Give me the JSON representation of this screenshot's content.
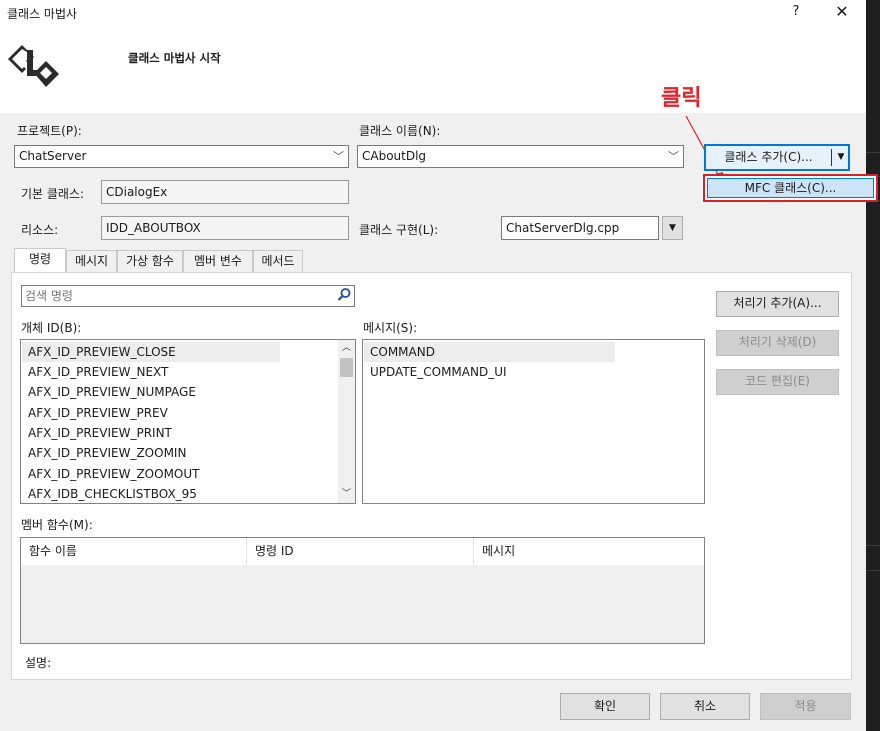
{
  "window": {
    "title": "클래스 마법사",
    "help_label": "?",
    "close_label": "✕",
    "wizard_start_label": "클래스 마법사 시작",
    "logo_icon": "class-wizard-icon"
  },
  "annotation": {
    "click_label": "클릭",
    "color": "#e8202a"
  },
  "project": {
    "label": "프로젝트(P):",
    "value": "ChatServer"
  },
  "class_name": {
    "label": "클래스 이름(N):",
    "value": "CAboutDlg"
  },
  "add_class": {
    "label": "클래스 추가(C)...",
    "dropdown_icon": "chevron-down-icon",
    "menu_item": "MFC 클래스(C)..."
  },
  "base_class": {
    "label": "기본 클래스:",
    "value": "CDialogEx"
  },
  "resource": {
    "label": "리소스:",
    "value": "IDD_ABOUTBOX"
  },
  "class_impl": {
    "label": "클래스 구현(L):",
    "value": "ChatServerDlg.cpp"
  },
  "tabs": [
    {
      "label": "명령"
    },
    {
      "label": "메시지"
    },
    {
      "label": "가상 함수"
    },
    {
      "label": "멤버 변수"
    },
    {
      "label": "메서드"
    }
  ],
  "search": {
    "placeholder": "검색 명령",
    "icon": "search-icon"
  },
  "object_ids": {
    "label": "개체 ID(B):",
    "items": [
      "AFX_ID_PREVIEW_CLOSE",
      "AFX_ID_PREVIEW_NEXT",
      "AFX_ID_PREVIEW_NUMPAGE",
      "AFX_ID_PREVIEW_PREV",
      "AFX_ID_PREVIEW_PRINT",
      "AFX_ID_PREVIEW_ZOOMIN",
      "AFX_ID_PREVIEW_ZOOMOUT",
      "AFX_IDB_CHECKLISTBOX_95"
    ]
  },
  "messages": {
    "label": "메시지(S):",
    "items": [
      "COMMAND",
      "UPDATE_COMMAND_UI"
    ]
  },
  "handler_buttons": {
    "add": "처리기 추가(A)...",
    "delete": "처리기 삭제(D)",
    "edit_code": "코드 편집(E)"
  },
  "member_functions": {
    "label": "멤버 함수(M):",
    "columns": [
      "함수 이름",
      "명령 ID",
      "메시지"
    ]
  },
  "description": {
    "label": "설명:"
  },
  "footer": {
    "ok": "확인",
    "cancel": "취소",
    "apply": "적용"
  }
}
